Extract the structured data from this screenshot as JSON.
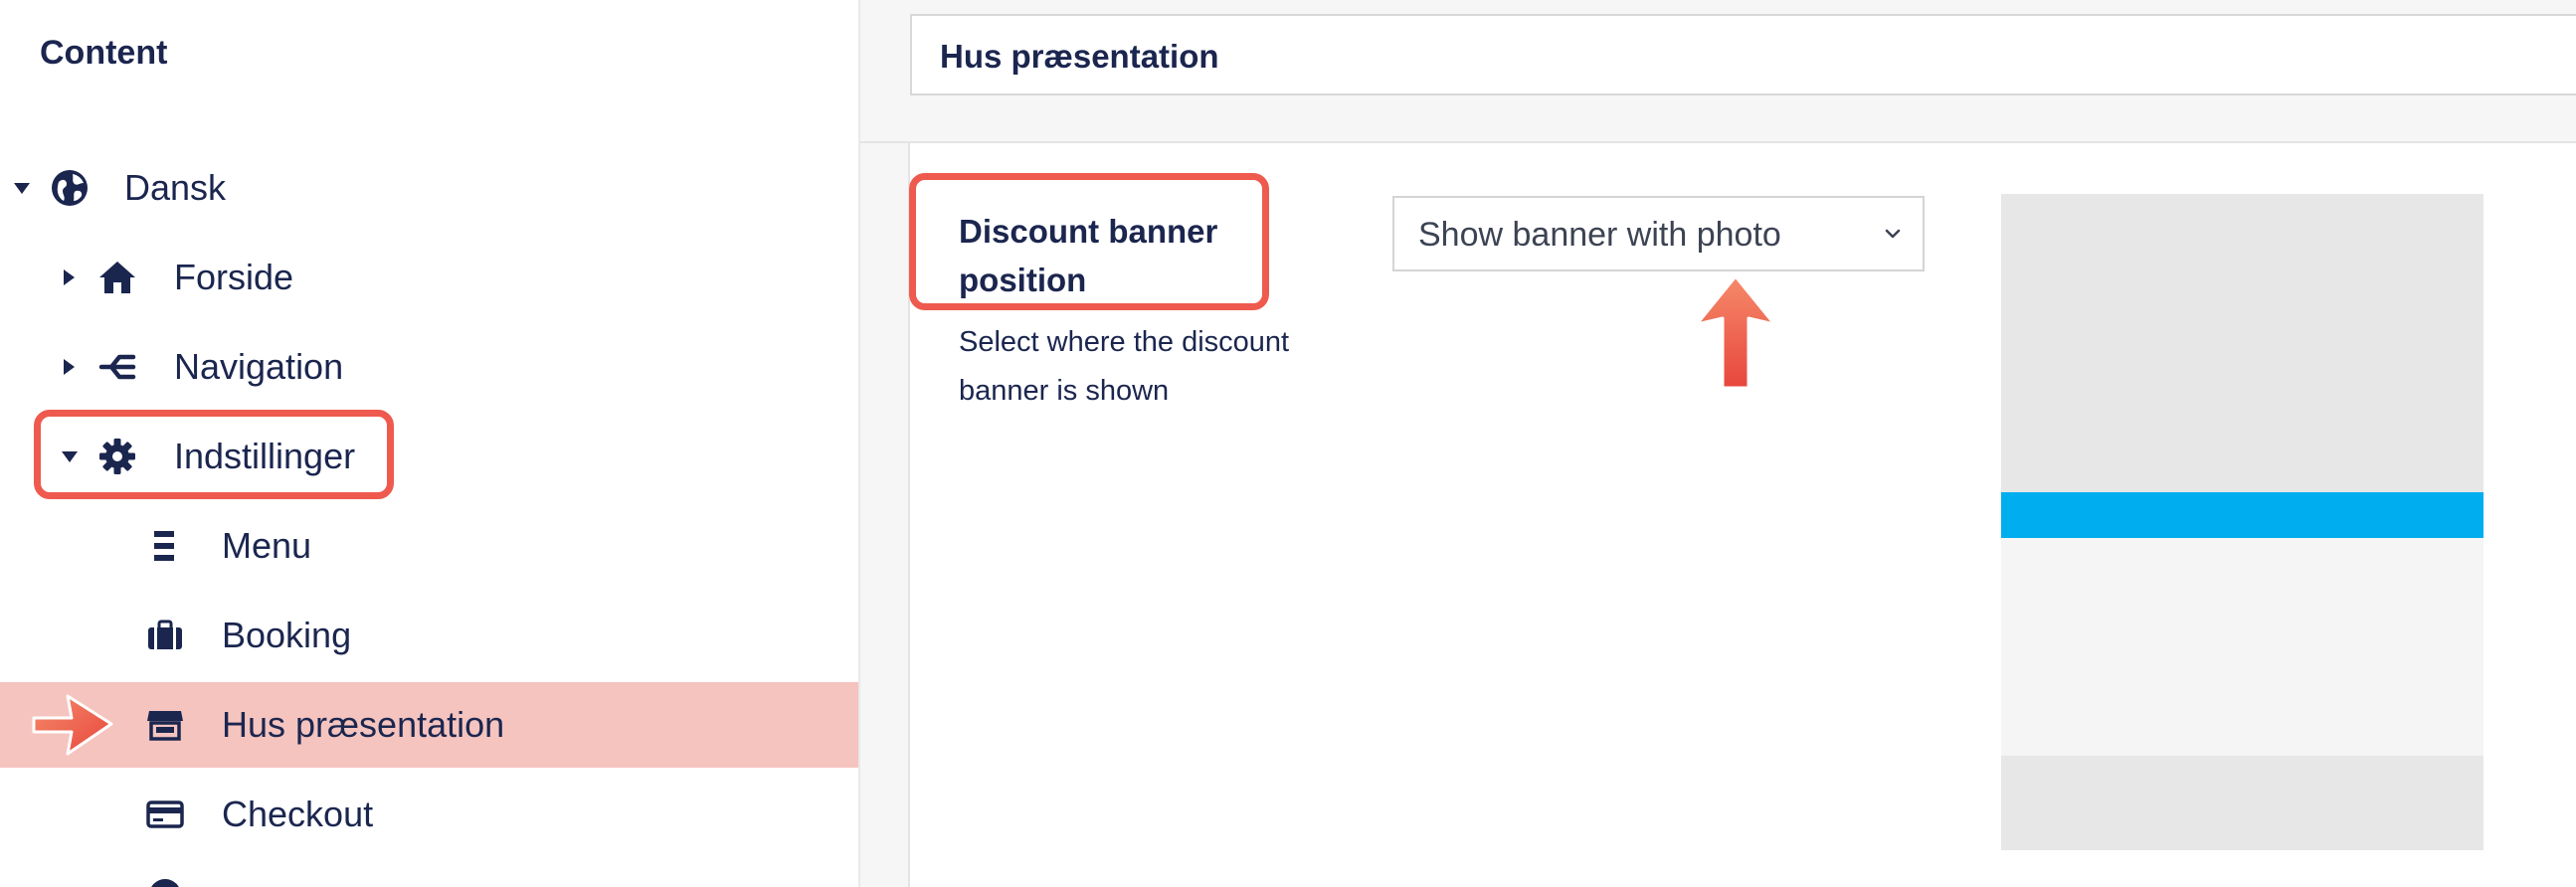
{
  "sidebar": {
    "title": "Content",
    "tree": [
      {
        "label": "Dansk",
        "icon": "globe-icon",
        "expanded": true,
        "level": 0
      },
      {
        "label": "Forside",
        "icon": "home-icon",
        "expanded": false,
        "level": 1
      },
      {
        "label": "Navigation",
        "icon": "sitemap-icon",
        "expanded": false,
        "level": 1
      },
      {
        "label": "Indstillinger",
        "icon": "gear-icon",
        "expanded": true,
        "level": 1
      },
      {
        "label": "Menu",
        "icon": "menu-bars-icon",
        "level": 2
      },
      {
        "label": "Booking",
        "icon": "briefcase-icon",
        "level": 2
      },
      {
        "label": "Hus præsentation",
        "icon": "store-icon",
        "level": 2,
        "active": true
      },
      {
        "label": "Checkout",
        "icon": "credit-card-icon",
        "level": 2
      }
    ]
  },
  "header": {
    "title": "Hus præsentation"
  },
  "property": {
    "label": "Discount banner position",
    "description": "Select where the discount banner is shown",
    "select": {
      "value": "Show banner with photo"
    }
  },
  "colors": {
    "highlight_red": "#ef5a4f",
    "active_row": "#f5c4bf",
    "banner_blue": "#00aeef",
    "text_navy": "#1b264f"
  }
}
